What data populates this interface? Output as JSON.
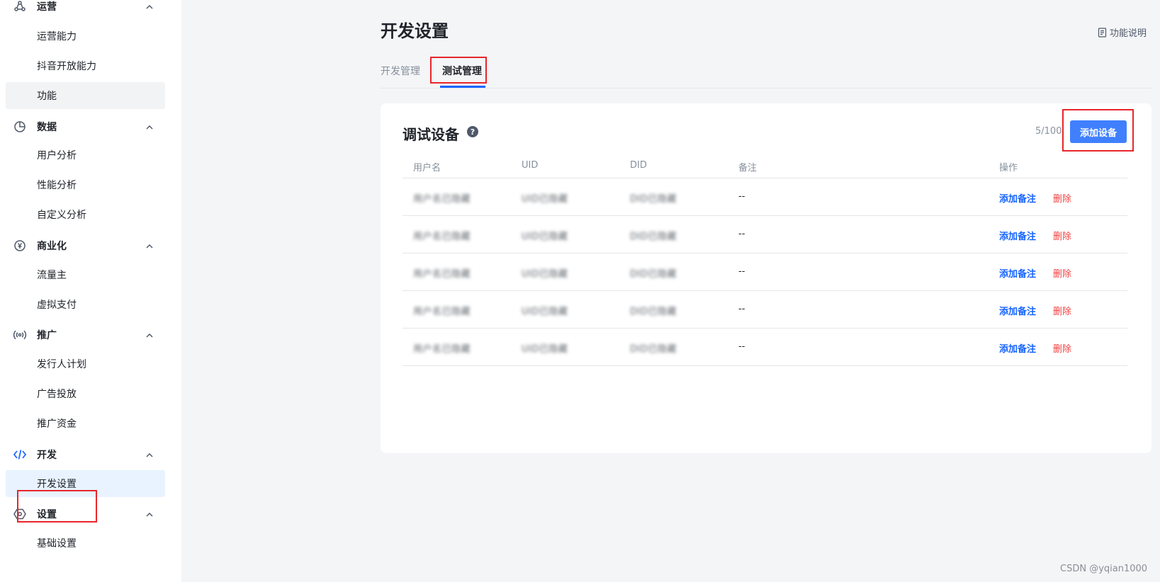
{
  "sidebar": {
    "groups": [
      {
        "label": "运营",
        "icon": "operations-icon",
        "items": [
          "运营能力",
          "抖音开放能力",
          "功能"
        ]
      },
      {
        "label": "数据",
        "icon": "pie-chart-icon",
        "items": [
          "用户分析",
          "性能分析",
          "自定义分析"
        ]
      },
      {
        "label": "商业化",
        "icon": "yen-icon",
        "items": [
          "流量主",
          "虚拟支付"
        ]
      },
      {
        "label": "推广",
        "icon": "broadcast-icon",
        "items": [
          "发行人计划",
          "广告投放",
          "推广资金"
        ]
      },
      {
        "label": "开发",
        "icon": "code-icon",
        "items": [
          "开发设置"
        ]
      },
      {
        "label": "设置",
        "icon": "settings-icon",
        "items": [
          "基础设置"
        ]
      }
    ],
    "active_item": "开发设置",
    "accent_color": "#1664ff"
  },
  "header": {
    "title": "开发设置",
    "help_label": "功能说明",
    "tabs": [
      {
        "label": "开发管理",
        "active": false
      },
      {
        "label": "测试管理",
        "active": true
      }
    ]
  },
  "devices": {
    "title": "调试设备",
    "help_icon": "?",
    "count": "5/100",
    "add_button": "添加设备",
    "columns": [
      "用户名",
      "UID",
      "DID",
      "备注",
      "操作"
    ],
    "rows": [
      {
        "username": "用户名已隐藏",
        "uid": "UID已隐藏",
        "did": "DID已隐藏",
        "note": "--",
        "action_note": "添加备注",
        "action_delete": "删除"
      },
      {
        "username": "用户名已隐藏",
        "uid": "UID已隐藏",
        "did": "DID已隐藏",
        "note": "--",
        "action_note": "添加备注",
        "action_delete": "删除"
      },
      {
        "username": "用户名已隐藏",
        "uid": "UID已隐藏",
        "did": "DID已隐藏",
        "note": "--",
        "action_note": "添加备注",
        "action_delete": "删除"
      },
      {
        "username": "用户名已隐藏",
        "uid": "UID已隐藏",
        "did": "DID已隐藏",
        "note": "--",
        "action_note": "添加备注",
        "action_delete": "删除"
      },
      {
        "username": "用户名已隐藏",
        "uid": "UID已隐藏",
        "did": "DID已隐藏",
        "note": "--",
        "action_note": "添加备注",
        "action_delete": "删除"
      }
    ],
    "primary_color": "#4080ff",
    "danger_color": "#f53f3f"
  },
  "watermark": "CSDN @yqian1000"
}
